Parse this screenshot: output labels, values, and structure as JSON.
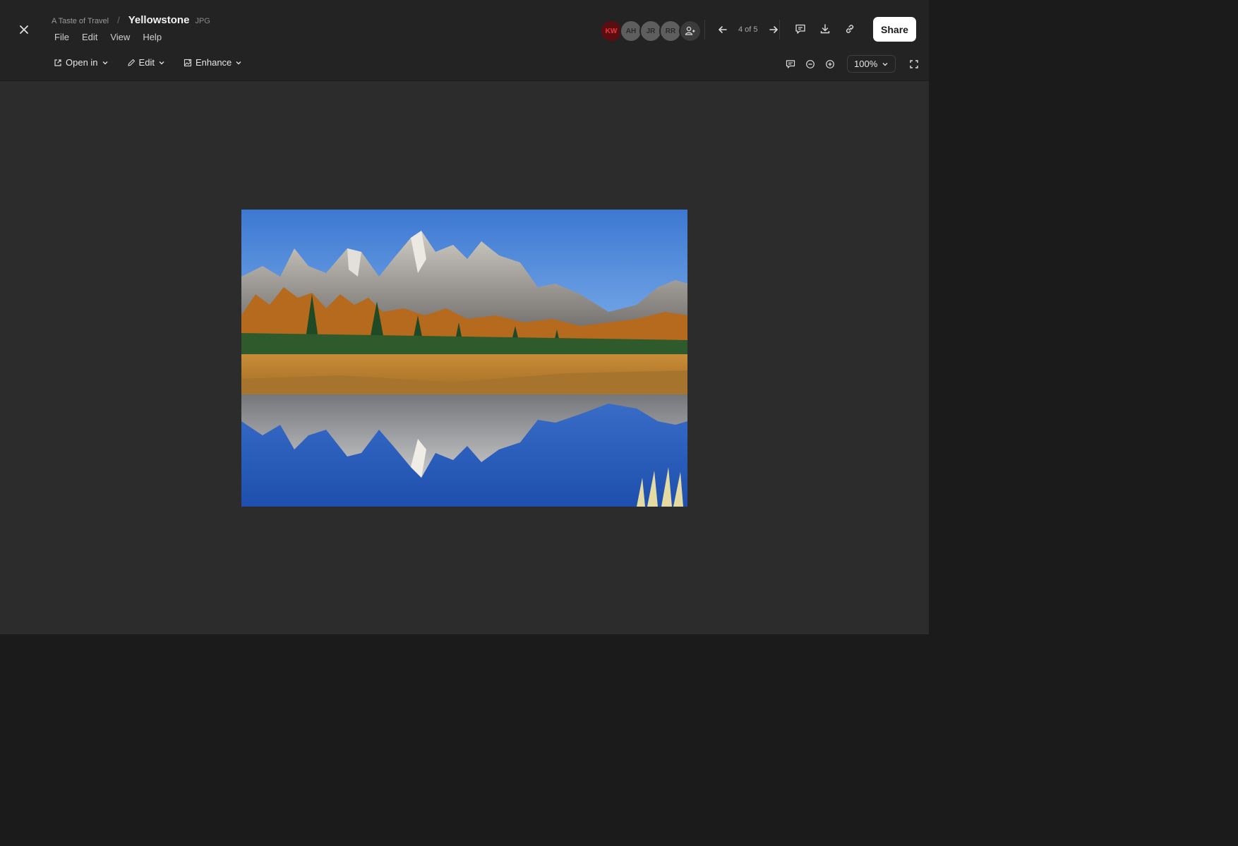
{
  "header": {
    "folder": "A Taste of Travel",
    "separator": "/",
    "file_title": "Yellowstone",
    "file_ext": "JPG"
  },
  "menu": {
    "items": [
      "File",
      "Edit",
      "View",
      "Help"
    ]
  },
  "collaborators": [
    {
      "initials": "KW",
      "color": "#5b0d12",
      "text_color": "#e23a3a"
    },
    {
      "initials": "AH",
      "color": "#5e5e5e",
      "text_color": "#2b2b2b"
    },
    {
      "initials": "JR",
      "color": "#5e5e5e",
      "text_color": "#2b2b2b"
    },
    {
      "initials": "RR",
      "color": "#5e5e5e",
      "text_color": "#2b2b2b"
    }
  ],
  "pager": {
    "label": "4 of 5"
  },
  "share_label": "Share",
  "toolbar": {
    "open_in": "Open in",
    "edit": "Edit",
    "enhance": "Enhance"
  },
  "zoom": {
    "level": "100%"
  },
  "icons": {
    "close": "close-icon",
    "prev": "arrow-left-icon",
    "next": "arrow-right-icon",
    "comment": "comment-icon",
    "download": "download-icon",
    "link": "link-icon",
    "open": "external-open-icon",
    "pencil": "pencil-icon",
    "enhance": "enhance-icon",
    "annotations": "comment-toggle-icon",
    "zoom_out": "zoom-out-icon",
    "zoom_in": "zoom-in-icon",
    "fullscreen": "fullscreen-icon"
  },
  "colors": {
    "background": "#1b1b1b",
    "panel": "#232323",
    "canvas": "#2c2c2c",
    "share_bg": "#ffffff"
  }
}
